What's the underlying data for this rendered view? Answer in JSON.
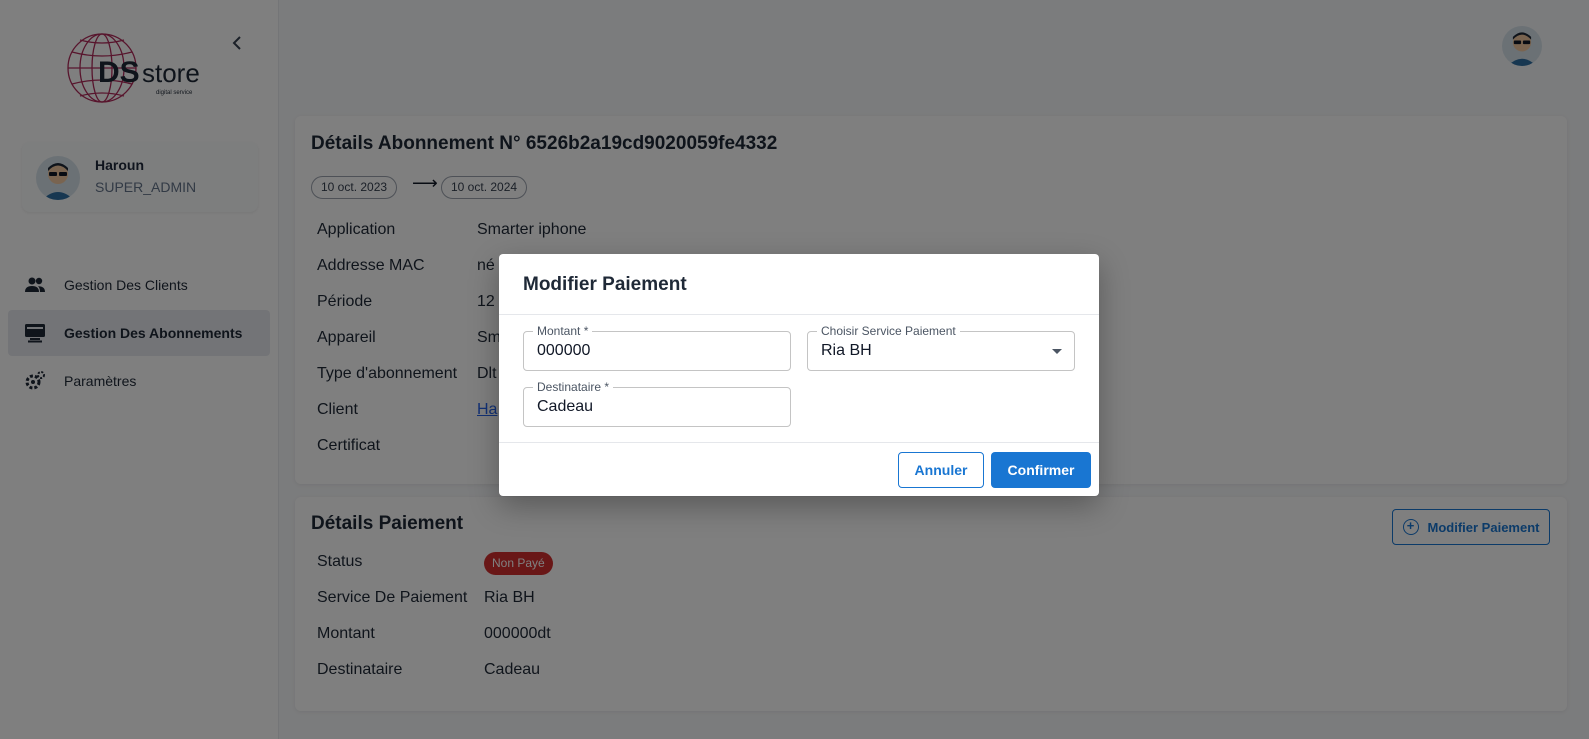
{
  "sidebar": {
    "logo_text": "DSstore",
    "logo_sub": "digital service",
    "user": {
      "name": "Haroun",
      "role": "SUPER_ADMIN"
    },
    "nav": [
      {
        "label": "Gestion Des Clients",
        "icon": "people-icon",
        "active": false
      },
      {
        "label": "Gestion Des Abonnements",
        "icon": "card-icon",
        "active": true
      },
      {
        "label": "Paramètres",
        "icon": "gear-icon",
        "active": false
      }
    ]
  },
  "subscription": {
    "title": "Détails Abonnement N° 6526b2a19cd9020059fe4332",
    "start_date": "10 oct. 2023",
    "arrow": "⟶",
    "end_date": "10 oct. 2024",
    "rows": [
      {
        "label": "Application",
        "value": "Smarter iphone"
      },
      {
        "label": "Addresse MAC",
        "value": "né"
      },
      {
        "label": "Période",
        "value": "12 l"
      },
      {
        "label": "Appareil",
        "value": "Sm"
      },
      {
        "label": "Type d'abonnement",
        "value": "Dlt"
      },
      {
        "label": "Client",
        "value": "Ha"
      },
      {
        "label": "Certificat",
        "value": ""
      }
    ]
  },
  "payment": {
    "title": "Détails Paiement",
    "modify_button": "Modifier Paiement",
    "status_label": "Status",
    "status_badge": "Non Payé",
    "status_color": "#d32f2f",
    "service_label": "Service De Paiement",
    "service_value": "Ria BH",
    "amount_label": "Montant",
    "amount_value": "000000dt",
    "recipient_label": "Destinataire",
    "recipient_value": "Cadeau"
  },
  "modal": {
    "title": "Modifier Paiement",
    "amount_label": "Montant *",
    "amount_value": "000000",
    "service_label": "Choisir Service Paiement",
    "service_value": "Ria BH",
    "recipient_label": "Destinataire *",
    "recipient_value": "Cadeau",
    "cancel": "Annuler",
    "confirm": "Confirmer"
  },
  "colors": {
    "accent": "#1976d2",
    "danger": "#d32f2f"
  }
}
